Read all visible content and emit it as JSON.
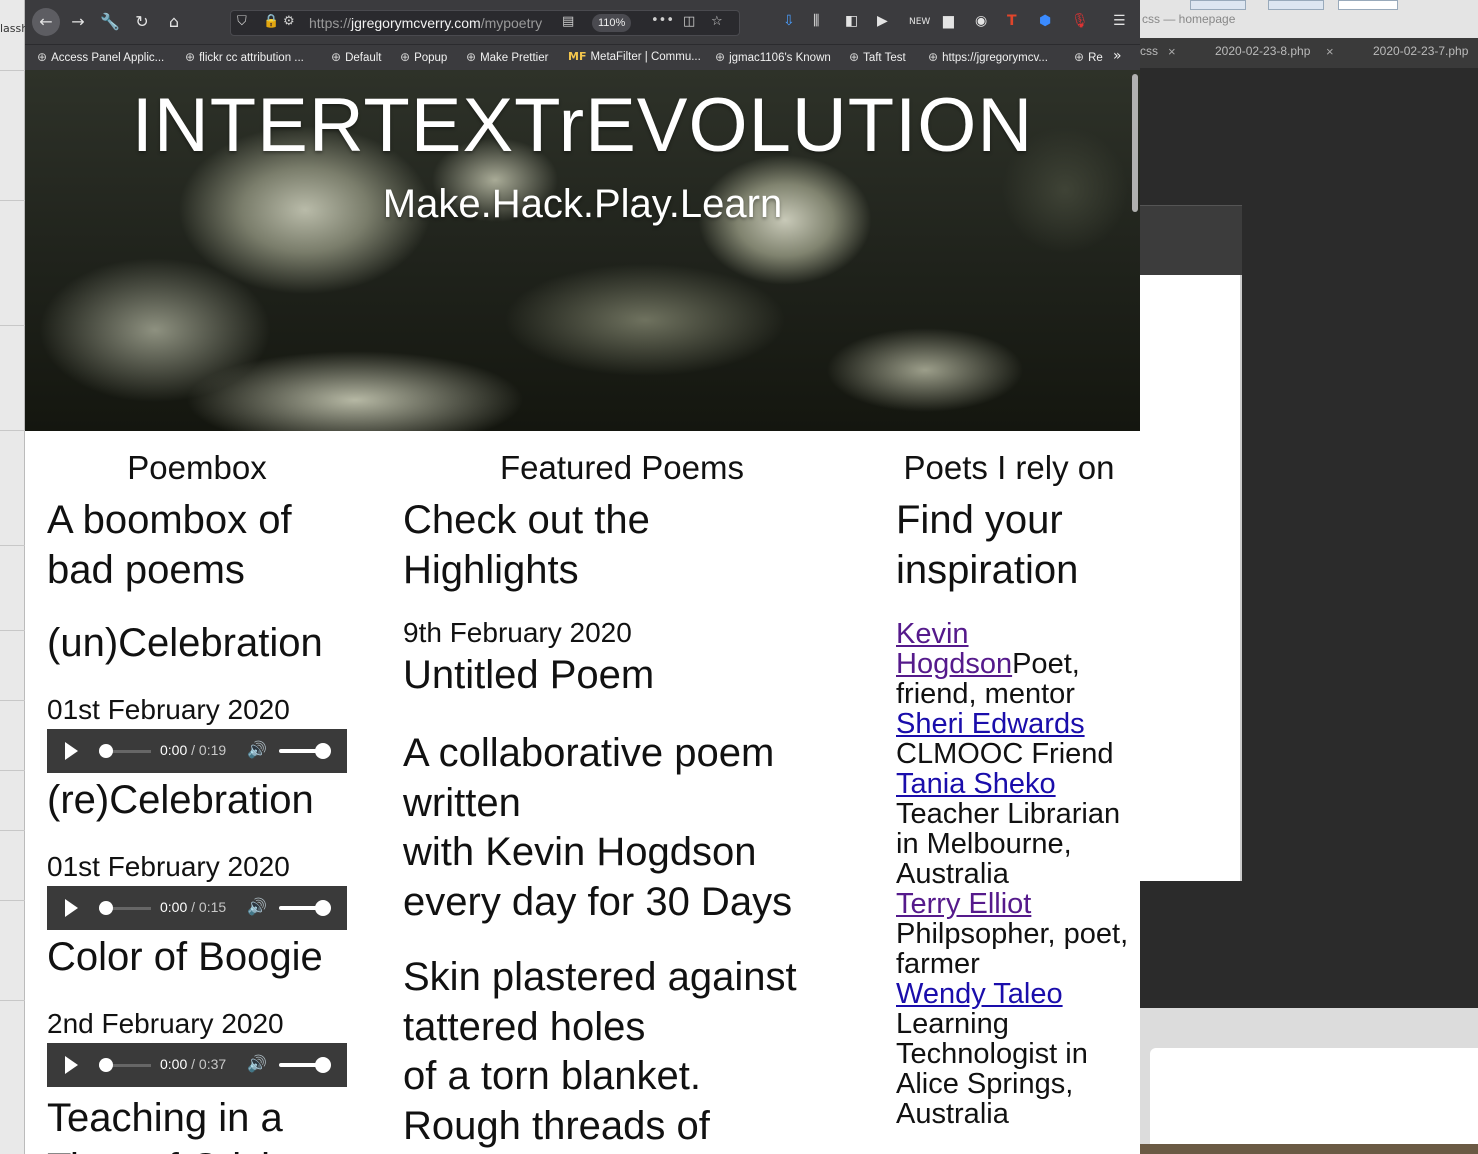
{
  "background": {
    "left_window_text": "lassh",
    "right_window_title": "css — homepage",
    "right_tabs": [
      {
        "label": "css"
      },
      {
        "label": "2020-02-23-8.php"
      },
      {
        "label": "2020-02-23-7.php"
      }
    ]
  },
  "browser": {
    "url_prefix": "https://",
    "url_domain": "jgregorymcverry.com",
    "url_path": "/mypoetry",
    "zoom": "110%",
    "bookmarks": [
      "Access Panel Applic...",
      "flickr cc attribution ...",
      "Default",
      "Popup",
      "Make Prettier",
      "MetaFilter | Commu...",
      "jgmac1106's Known",
      "Taft Test",
      "https://jgregorymcv...",
      "Re"
    ],
    "metafilter_icon_text": "MF"
  },
  "page": {
    "site_title": "INTERTEXTrEVOLUTION",
    "tagline": "Make.Hack.Play.Learn",
    "poembox": {
      "heading": "Poembox",
      "subheading": "A boombox of bad poems",
      "items": [
        {
          "title": "(un)Celebration",
          "date": "01st February 2020",
          "current": "0:00",
          "duration": "/ 0:19"
        },
        {
          "title": "(re)Celebration",
          "date": "01st February 2020",
          "current": "0:00",
          "duration": "/ 0:15"
        },
        {
          "title": "Color of Boogie",
          "date": "2nd February 2020",
          "current": "0:00",
          "duration": "/ 0:37"
        },
        {
          "title": "Teaching in a Time of Crisis"
        }
      ]
    },
    "featured": {
      "heading": "Featured Poems",
      "subheading": "Check out the Highlights",
      "date": "9th February 2020",
      "title": "Untitled Poem",
      "intro_lines": [
        "A collaborative poem written",
        "with Kevin Hogdson",
        "every day for 30 Days"
      ],
      "poem_lines": [
        "Skin plastered against",
        "tattered holes",
        "of a torn blanket.",
        "Rough threads of"
      ]
    },
    "poets": {
      "heading": "Poets I rely on",
      "subheading": "Find your inspiration",
      "list": [
        {
          "name": "Kevin Hogdson",
          "desc": "Poet, friend, mentor",
          "visited": true
        },
        {
          "name": "Sheri Edwards",
          "desc": "CLMOOC Friend",
          "visited": false
        },
        {
          "name": "Tania Sheko",
          "desc": "Teacher Librarian in Melbourne, Australia",
          "visited": false
        },
        {
          "name": "Terry Elliot",
          "desc": "Philpsopher, poet, farmer",
          "visited": true
        },
        {
          "name": "Wendy Taleo",
          "desc": "Learning Technologist in Alice Springs, Australia",
          "visited": false
        }
      ]
    }
  },
  "colors": {
    "link": "#1a0dab",
    "link_visited": "#551a8b",
    "toolbar": "#3b3b3e",
    "audio_bg": "#3a3a3a"
  }
}
